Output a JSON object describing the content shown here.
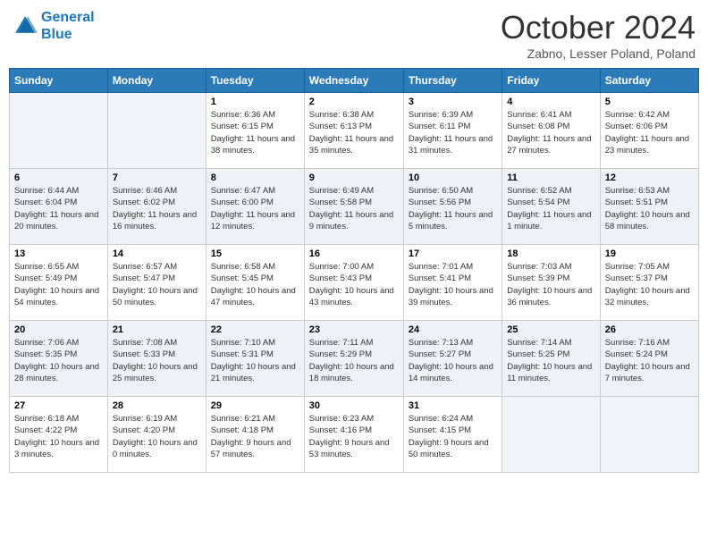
{
  "header": {
    "logo_line1": "General",
    "logo_line2": "Blue",
    "month": "October 2024",
    "location": "Zabno, Lesser Poland, Poland"
  },
  "days_of_week": [
    "Sunday",
    "Monday",
    "Tuesday",
    "Wednesday",
    "Thursday",
    "Friday",
    "Saturday"
  ],
  "weeks": [
    [
      {
        "day": "",
        "info": ""
      },
      {
        "day": "",
        "info": ""
      },
      {
        "day": "1",
        "info": "Sunrise: 6:36 AM\nSunset: 6:15 PM\nDaylight: 11 hours and 38 minutes."
      },
      {
        "day": "2",
        "info": "Sunrise: 6:38 AM\nSunset: 6:13 PM\nDaylight: 11 hours and 35 minutes."
      },
      {
        "day": "3",
        "info": "Sunrise: 6:39 AM\nSunset: 6:11 PM\nDaylight: 11 hours and 31 minutes."
      },
      {
        "day": "4",
        "info": "Sunrise: 6:41 AM\nSunset: 6:08 PM\nDaylight: 11 hours and 27 minutes."
      },
      {
        "day": "5",
        "info": "Sunrise: 6:42 AM\nSunset: 6:06 PM\nDaylight: 11 hours and 23 minutes."
      }
    ],
    [
      {
        "day": "6",
        "info": "Sunrise: 6:44 AM\nSunset: 6:04 PM\nDaylight: 11 hours and 20 minutes."
      },
      {
        "day": "7",
        "info": "Sunrise: 6:46 AM\nSunset: 6:02 PM\nDaylight: 11 hours and 16 minutes."
      },
      {
        "day": "8",
        "info": "Sunrise: 6:47 AM\nSunset: 6:00 PM\nDaylight: 11 hours and 12 minutes."
      },
      {
        "day": "9",
        "info": "Sunrise: 6:49 AM\nSunset: 5:58 PM\nDaylight: 11 hours and 9 minutes."
      },
      {
        "day": "10",
        "info": "Sunrise: 6:50 AM\nSunset: 5:56 PM\nDaylight: 11 hours and 5 minutes."
      },
      {
        "day": "11",
        "info": "Sunrise: 6:52 AM\nSunset: 5:54 PM\nDaylight: 11 hours and 1 minute."
      },
      {
        "day": "12",
        "info": "Sunrise: 6:53 AM\nSunset: 5:51 PM\nDaylight: 10 hours and 58 minutes."
      }
    ],
    [
      {
        "day": "13",
        "info": "Sunrise: 6:55 AM\nSunset: 5:49 PM\nDaylight: 10 hours and 54 minutes."
      },
      {
        "day": "14",
        "info": "Sunrise: 6:57 AM\nSunset: 5:47 PM\nDaylight: 10 hours and 50 minutes."
      },
      {
        "day": "15",
        "info": "Sunrise: 6:58 AM\nSunset: 5:45 PM\nDaylight: 10 hours and 47 minutes."
      },
      {
        "day": "16",
        "info": "Sunrise: 7:00 AM\nSunset: 5:43 PM\nDaylight: 10 hours and 43 minutes."
      },
      {
        "day": "17",
        "info": "Sunrise: 7:01 AM\nSunset: 5:41 PM\nDaylight: 10 hours and 39 minutes."
      },
      {
        "day": "18",
        "info": "Sunrise: 7:03 AM\nSunset: 5:39 PM\nDaylight: 10 hours and 36 minutes."
      },
      {
        "day": "19",
        "info": "Sunrise: 7:05 AM\nSunset: 5:37 PM\nDaylight: 10 hours and 32 minutes."
      }
    ],
    [
      {
        "day": "20",
        "info": "Sunrise: 7:06 AM\nSunset: 5:35 PM\nDaylight: 10 hours and 28 minutes."
      },
      {
        "day": "21",
        "info": "Sunrise: 7:08 AM\nSunset: 5:33 PM\nDaylight: 10 hours and 25 minutes."
      },
      {
        "day": "22",
        "info": "Sunrise: 7:10 AM\nSunset: 5:31 PM\nDaylight: 10 hours and 21 minutes."
      },
      {
        "day": "23",
        "info": "Sunrise: 7:11 AM\nSunset: 5:29 PM\nDaylight: 10 hours and 18 minutes."
      },
      {
        "day": "24",
        "info": "Sunrise: 7:13 AM\nSunset: 5:27 PM\nDaylight: 10 hours and 14 minutes."
      },
      {
        "day": "25",
        "info": "Sunrise: 7:14 AM\nSunset: 5:25 PM\nDaylight: 10 hours and 11 minutes."
      },
      {
        "day": "26",
        "info": "Sunrise: 7:16 AM\nSunset: 5:24 PM\nDaylight: 10 hours and 7 minutes."
      }
    ],
    [
      {
        "day": "27",
        "info": "Sunrise: 6:18 AM\nSunset: 4:22 PM\nDaylight: 10 hours and 3 minutes."
      },
      {
        "day": "28",
        "info": "Sunrise: 6:19 AM\nSunset: 4:20 PM\nDaylight: 10 hours and 0 minutes."
      },
      {
        "day": "29",
        "info": "Sunrise: 6:21 AM\nSunset: 4:18 PM\nDaylight: 9 hours and 57 minutes."
      },
      {
        "day": "30",
        "info": "Sunrise: 6:23 AM\nSunset: 4:16 PM\nDaylight: 9 hours and 53 minutes."
      },
      {
        "day": "31",
        "info": "Sunrise: 6:24 AM\nSunset: 4:15 PM\nDaylight: 9 hours and 50 minutes."
      },
      {
        "day": "",
        "info": ""
      },
      {
        "day": "",
        "info": ""
      }
    ]
  ]
}
